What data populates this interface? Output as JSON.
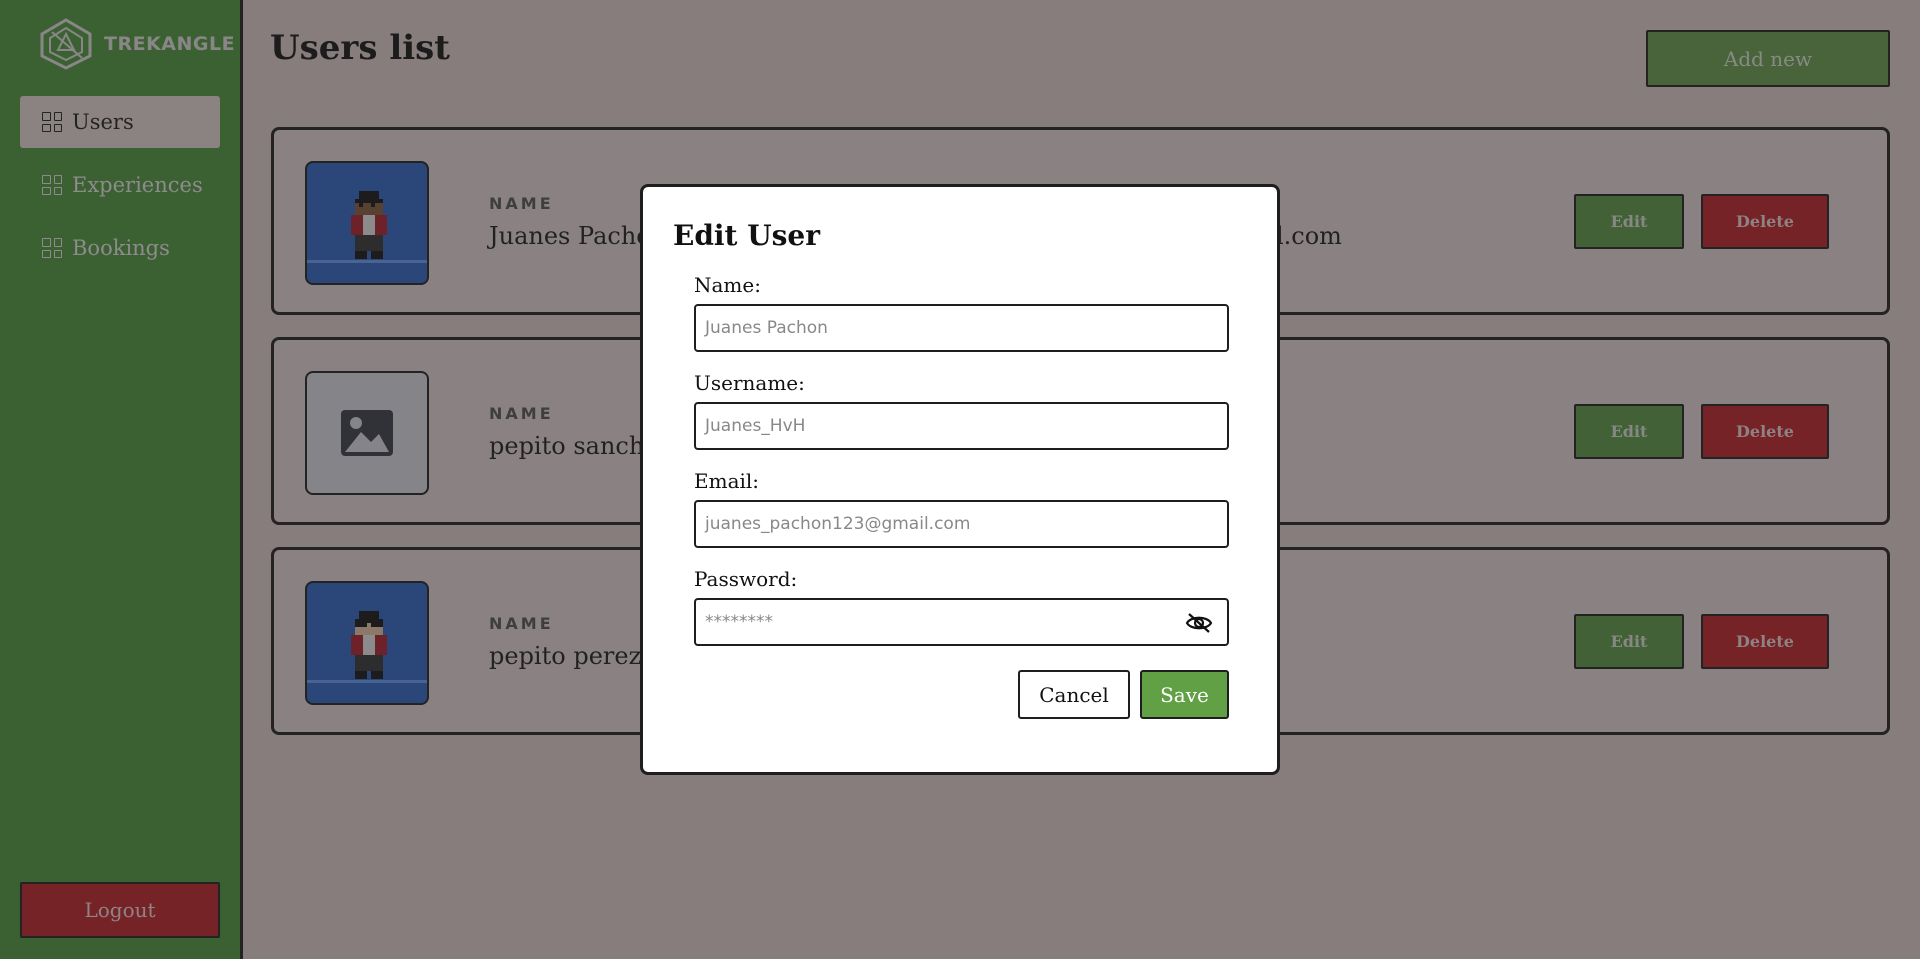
{
  "sidebar": {
    "brand": "TREKANGLE",
    "items": [
      {
        "label": "Users",
        "active": true
      },
      {
        "label": "Experiences",
        "active": false
      },
      {
        "label": "Bookings",
        "active": false
      }
    ],
    "logout_label": "Logout"
  },
  "main": {
    "title": "Users list",
    "add_new_label": "Add new",
    "users": [
      {
        "field_label": "NAME",
        "name": "Juanes Pacho",
        "email_fragment": "ail.com",
        "avatar": "pixel-avatar",
        "edit": "Edit",
        "delete": "Delete"
      },
      {
        "field_label": "NAME",
        "name": "pepito sanch",
        "email_fragment": "",
        "avatar": "image-placeholder-icon",
        "edit": "Edit",
        "delete": "Delete"
      },
      {
        "field_label": "NAME",
        "name": "pepito perez",
        "email_fragment": "",
        "avatar": "pixel-avatar-glasses",
        "edit": "Edit",
        "delete": "Delete"
      }
    ]
  },
  "modal": {
    "title": "Edit User",
    "name_label": "Name:",
    "name_value": "Juanes Pachon",
    "username_label": "Username:",
    "username_value": "Juanes_HvH",
    "email_label": "Email:",
    "email_value": "juanes_pachon123@gmail.com",
    "password_label": "Password:",
    "password_value": "********",
    "cancel_label": "Cancel",
    "save_label": "Save"
  },
  "colors": {
    "sidebar": "#4f9a3c",
    "accent_green": "#61a044",
    "danger_red": "#c41e26",
    "background": "#e9d3d3"
  }
}
